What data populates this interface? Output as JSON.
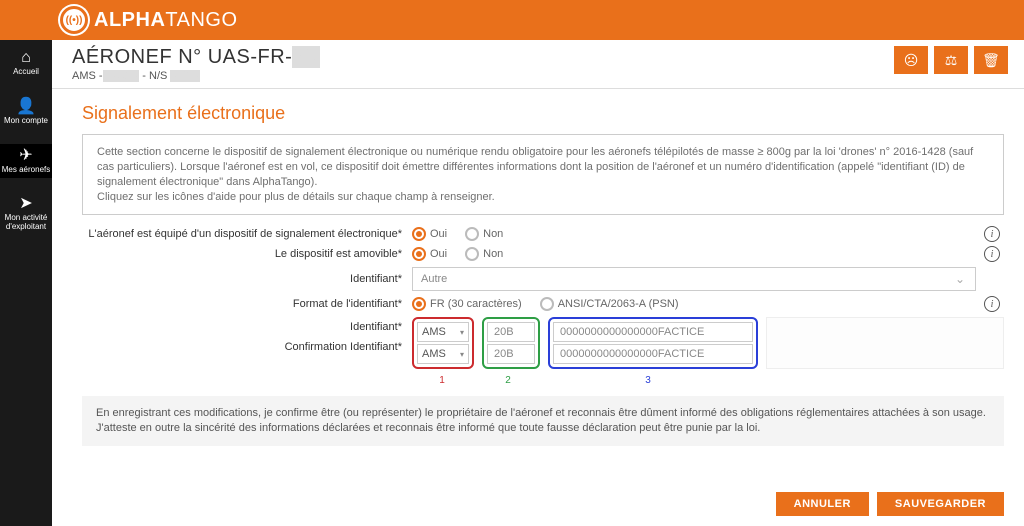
{
  "brand": {
    "name_a": "ALPHA",
    "name_b": "TANGO"
  },
  "sidebar": {
    "items": [
      {
        "icon": "⌂",
        "label": "Accueil"
      },
      {
        "icon": "👤",
        "label": "Mon compte"
      },
      {
        "icon": "✈",
        "label": "Mes aéronefs"
      },
      {
        "icon": "➤",
        "label": "Mon activité d'exploitant"
      }
    ]
  },
  "header": {
    "title_prefix": "AÉRONEF N° UAS-FR-",
    "subtitle_prefix": "AMS -",
    "subtitle_mid": " - N/S "
  },
  "section": {
    "title": "Signalement électronique",
    "info": "Cette section concerne le dispositif de signalement électronique ou numérique rendu obligatoire pour les aéronefs télépilotés de masse ≥ 800g par la loi 'drones' n° 2016-1428 (sauf cas particuliers). Lorsque l'aéronef est en vol, ce dispositif doit émettre différentes informations dont la position de l'aéronef et un numéro d'identification (appelé \"identifiant (ID) de signalement électronique\" dans AlphaTango).\nCliquez sur les icônes d'aide pour plus de détails sur chaque champ à renseigner."
  },
  "form": {
    "q_equipped": "L'aéronef est équipé d'un dispositif de signalement électronique*",
    "q_removable": "Le dispositif est amovible*",
    "q_identifier": "Identifiant*",
    "q_format": "Format de l'identifiant*",
    "q_id": "Identifiant*",
    "q_confirm": "Confirmation Identifiant*",
    "yes": "Oui",
    "no": "Non",
    "identifier_select": "Autre",
    "fmt_fr": "FR (30 caractères)",
    "fmt_ansi": "ANSI/CTA/2063-A (PSN)",
    "id_part1": "AMS",
    "id_part2": "20B",
    "id_part3": "0000000000000000FACTICE",
    "confirm_part1": "AMS",
    "confirm_part2": "20B",
    "confirm_part3": "0000000000000000FACTICE",
    "marker1": "1",
    "marker2": "2",
    "marker3": "3"
  },
  "disclaimer": "En enregistrant ces modifications, je confirme être (ou représenter) le propriétaire de l'aéronef et reconnais être dûment informé des obligations réglementaires attachées à son usage.\nJ'atteste en outre la sincérité des informations déclarées et reconnais être informé que toute fausse déclaration peut être punie par la loi.",
  "buttons": {
    "cancel": "ANNULER",
    "save": "SAUVEGARDER"
  }
}
